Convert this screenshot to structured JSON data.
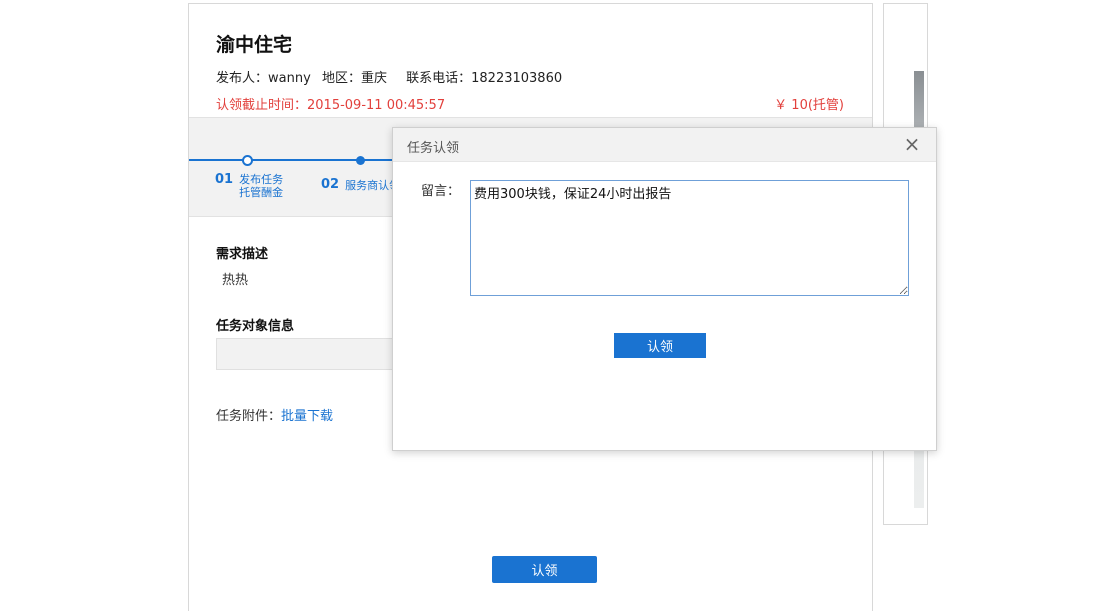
{
  "task": {
    "title": "渝中住宅",
    "publisher_label": "发布人：",
    "publisher": "wanny",
    "region_label": "地区：",
    "region": "重庆",
    "phone_label": "联系电话：",
    "phone": "18223103860",
    "deadline_label": "认领截止时间：",
    "deadline": "2015-09-11 00:45:57",
    "price": "￥ 10(托管)"
  },
  "steps": [
    {
      "num": "01",
      "line1": "发布任务",
      "line2": "托管酬金"
    },
    {
      "num": "02",
      "label": "服务商认领"
    }
  ],
  "sections": {
    "description_heading": "需求描述",
    "description_text": "热热",
    "object_heading": "任务对象信息",
    "attachment_label": "任务附件：",
    "attachment_link": "批量下载"
  },
  "main_claim_button": "认领",
  "dialog": {
    "title": "任务认领",
    "close_symbol": "×",
    "message_label": "留言：",
    "message_value": "费用300块钱，保证24小时出报告",
    "claim_button": "认领"
  },
  "colors": {
    "accent": "#1a73d1",
    "deadline": "#e2403c"
  }
}
